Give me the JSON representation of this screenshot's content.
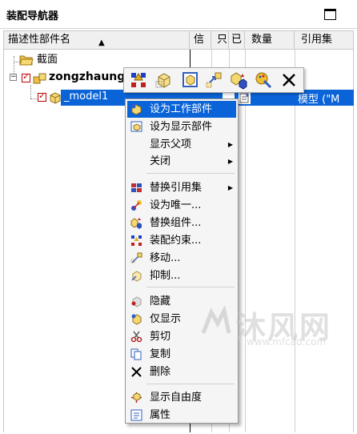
{
  "panel": {
    "title": "装配导航器"
  },
  "columns": {
    "name": "描述性部件名",
    "info": "信",
    "c1": "只",
    "c2": "已",
    "qty": "数量",
    "refset": "引用集"
  },
  "tree": {
    "section_label": "截面",
    "assembly_label": "zongzhaung",
    "child_label": "_model1",
    "child_refset": "模型 (\"M"
  },
  "toolbar": {
    "buttons": [
      "assembly-constraints-icon",
      "component-box-icon",
      "work-part-icon",
      "move-component-icon",
      "replace-component-icon",
      "properties-brush-icon",
      "delete-x-icon"
    ]
  },
  "menu": {
    "items": [
      {
        "label": "设为工作部件",
        "icon": "work-part-icon"
      },
      {
        "label": "设为显示部件",
        "icon": "display-part-icon"
      },
      {
        "label": "显示父项",
        "icon": ""
      },
      {
        "label": "关闭",
        "icon": ""
      },
      {
        "label": "替换引用集",
        "icon": "reference-set-icon"
      },
      {
        "label": "设为唯一...",
        "icon": "make-unique-icon"
      },
      {
        "label": "替换组件...",
        "icon": "replace-component-icon"
      },
      {
        "label": "装配约束...",
        "icon": "assembly-constraints-icon"
      },
      {
        "label": "移动...",
        "icon": "move-icon"
      },
      {
        "label": "抑制...",
        "icon": "suppress-icon"
      },
      {
        "label": "隐藏",
        "icon": "hide-icon"
      },
      {
        "label": "仅显示",
        "icon": "show-only-icon"
      },
      {
        "label": "剪切",
        "icon": "scissors-icon"
      },
      {
        "label": "复制",
        "icon": "copy-icon"
      },
      {
        "label": "删除",
        "icon": "delete-x-icon"
      },
      {
        "label": "显示自由度",
        "icon": "degrees-of-freedom-icon"
      },
      {
        "label": "属性",
        "icon": "properties-icon"
      }
    ]
  },
  "watermark": {
    "brand": "沐风网",
    "url": "www.mfcad.com"
  },
  "colors": {
    "selection": "#0a64d8",
    "menu_bg": "#f5f5f5",
    "check_red": "#c00000"
  }
}
